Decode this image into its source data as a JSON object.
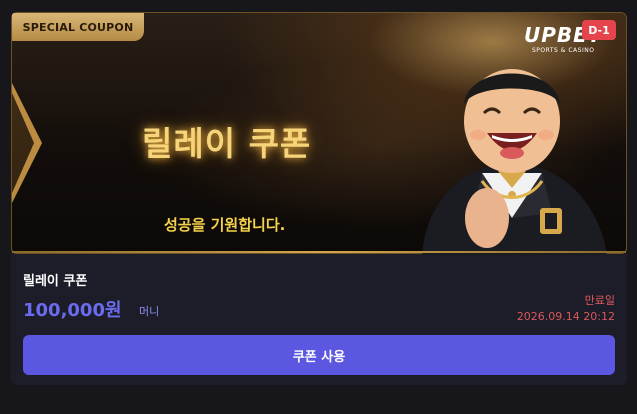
{
  "banner": {
    "tab_label": "SPECIAL COUPON",
    "title": "릴레이 쿠폰",
    "subtitle": "성공을 기원합니다.",
    "logo_main": "UPBET",
    "logo_sub": "SPORTS & CASINO",
    "dday": "D-1"
  },
  "coupon": {
    "name": "릴레이 쿠폰",
    "amount": "100,000원",
    "amount_unit": "머니",
    "expire_label": "만료일",
    "expire_date": "2026.09.14 20:12",
    "use_button": "쿠폰 사용"
  }
}
